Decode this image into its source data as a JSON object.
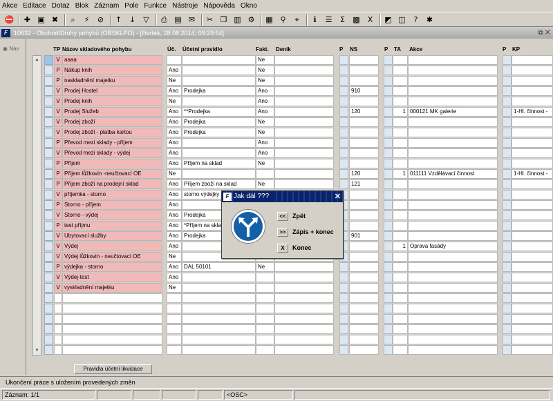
{
  "menu": [
    "Akce",
    "Editace",
    "Dotaz",
    "Blok",
    "Záznam",
    "Pole",
    "Funkce",
    "Nástroje",
    "Nápověda",
    "Okno"
  ],
  "toolbar_icons": [
    "exit-icon",
    "new-record-icon",
    "save-icon",
    "delete-icon",
    "query-icon",
    "execute-query-icon",
    "cancel-query-icon",
    "sort-asc-icon",
    "sort-desc-icon",
    "filter-icon",
    "print-icon",
    "print-preview-icon",
    "mail-icon",
    "cut-icon",
    "copy-icon",
    "paste-icon",
    "tools-icon",
    "calendar-icon",
    "attach-icon",
    "find-icon",
    "info-icon",
    "list-icon",
    "sum-icon",
    "calculator-icon",
    "excel-icon",
    "chart-icon",
    "window-icon",
    "help-icon",
    "settings-icon"
  ],
  "window": {
    "title": "10632 - Obchod/Druhy pohybů (OBSKLPO) - [čtvrtek, 28.08.2014; 09:29:54]"
  },
  "nav": {
    "label": "Nav"
  },
  "columns": {
    "tp": "TP",
    "name": "Název skladového pohybu",
    "uc": "Úč.",
    "rule": "Účetní pravidlo",
    "fakt": "Fakt.",
    "denik": "Deník",
    "p1": "P",
    "ns": "NS",
    "p2": "P",
    "ta": "TA",
    "akce": "Akce",
    "p3": "P",
    "kp": "KP"
  },
  "rows": [
    {
      "tp": "V",
      "name": "aaaa",
      "uc": "",
      "rule": "",
      "fakt": "Ne",
      "ns": "",
      "ta": "",
      "akce": "",
      "kp": ""
    },
    {
      "tp": "P",
      "name": "Nákup knih",
      "uc": "Ano",
      "rule": "",
      "fakt": "Ne",
      "ns": "",
      "ta": "",
      "akce": "",
      "kp": ""
    },
    {
      "tp": "P",
      "name": "naskladnění majetku",
      "uc": "Ne",
      "rule": "",
      "fakt": "Ne",
      "ns": "",
      "ta": "",
      "akce": "",
      "kp": ""
    },
    {
      "tp": "V",
      "name": "Prodej Hostel",
      "uc": "Ano",
      "rule": "Prodejka",
      "fakt": "Ano",
      "ns": "910",
      "ta": "",
      "akce": "",
      "kp": ""
    },
    {
      "tp": "V",
      "name": "Prodej knih",
      "uc": "Ne",
      "rule": "",
      "fakt": "Ano",
      "ns": "",
      "ta": "",
      "akce": "",
      "kp": ""
    },
    {
      "tp": "V",
      "name": "Prodej Služeb",
      "uc": "Ano",
      "rule": "**Prodejka",
      "fakt": "Ano",
      "ns": "120",
      "ta": "1",
      "akce": "000121 MK galerie",
      "kp": "1-Hl. činnost -"
    },
    {
      "tp": "V",
      "name": "Prodej zboží",
      "uc": "Ano",
      "rule": "Prodejka",
      "fakt": "Ne",
      "ns": "",
      "ta": "",
      "akce": "",
      "kp": ""
    },
    {
      "tp": "V",
      "name": "Prodej zboží - platba kartou",
      "uc": "Ano",
      "rule": "Prodejka",
      "fakt": "Ne",
      "ns": "",
      "ta": "",
      "akce": "",
      "kp": ""
    },
    {
      "tp": "P",
      "name": "Převod mezi sklady - příjem",
      "uc": "Ano",
      "rule": "",
      "fakt": "Ano",
      "ns": "",
      "ta": "",
      "akce": "",
      "kp": ""
    },
    {
      "tp": "V",
      "name": "Převod mezi sklady - výdej",
      "uc": "Ano",
      "rule": "",
      "fakt": "Ano",
      "ns": "",
      "ta": "",
      "akce": "",
      "kp": ""
    },
    {
      "tp": "P",
      "name": "Příjem",
      "uc": "Ano",
      "rule": "Příjem na sklad",
      "fakt": "Ne",
      "ns": "",
      "ta": "",
      "akce": "",
      "kp": ""
    },
    {
      "tp": "P",
      "name": "Příjem lůžkovin -neučtovací OE",
      "uc": "Ne",
      "rule": "",
      "fakt": "",
      "ns": "120",
      "ta": "1",
      "akce": "011111 Vzdělávací činnost",
      "kp": "1-Hl. činnost -"
    },
    {
      "tp": "P",
      "name": "Příjem zboží na prodejní sklad",
      "uc": "Ano",
      "rule": "Příjem zboží na sklad",
      "fakt": "Ne",
      "ns": "121",
      "ta": "",
      "akce": "",
      "kp": ""
    },
    {
      "tp": "V",
      "name": "příjemka - storno",
      "uc": "Ano",
      "rule": "storno výdejky",
      "fakt": "",
      "ns": "",
      "ta": "",
      "akce": "",
      "kp": ""
    },
    {
      "tp": "P",
      "name": "Storno - příjem",
      "uc": "Ano",
      "rule": "",
      "fakt": "",
      "ns": "",
      "ta": "",
      "akce": "",
      "kp": ""
    },
    {
      "tp": "V",
      "name": "Storno - výdej",
      "uc": "Ano",
      "rule": "Prodejka",
      "fakt": "",
      "ns": "",
      "ta": "",
      "akce": "",
      "kp": ""
    },
    {
      "tp": "P",
      "name": "test příjmu",
      "uc": "Ano",
      "rule": "*Příjem na sklad",
      "fakt": "",
      "ns": "",
      "ta": "",
      "akce": "",
      "kp": ""
    },
    {
      "tp": "V",
      "name": "Ubytovací služby",
      "uc": "Ano",
      "rule": "Prodejka",
      "fakt": "",
      "ns": "901",
      "ta": "",
      "akce": "",
      "kp": ""
    },
    {
      "tp": "V",
      "name": "Výdej",
      "uc": "Ano",
      "rule": "",
      "fakt": "",
      "ns": "",
      "ta": "1",
      "akce": "Oprava fasády",
      "kp": ""
    },
    {
      "tp": "V",
      "name": "Výdej lůžkovin - neučtovací OE",
      "uc": "Ne",
      "rule": "",
      "fakt": "",
      "ns": "",
      "ta": "",
      "akce": "",
      "kp": ""
    },
    {
      "tp": "P",
      "name": "výdejka - storno",
      "uc": "Ano",
      "rule": "DAL 50101",
      "fakt": "Ne",
      "ns": "",
      "ta": "",
      "akce": "",
      "kp": ""
    },
    {
      "tp": "V",
      "name": "Výdej-test",
      "uc": "Ano",
      "rule": "",
      "fakt": "",
      "ns": "",
      "ta": "",
      "akce": "",
      "kp": ""
    },
    {
      "tp": "V",
      "name": "vyskladnění majetku",
      "uc": "Ne",
      "rule": "",
      "fakt": "",
      "ns": "",
      "ta": "",
      "akce": "",
      "kp": ""
    },
    {
      "tp": "",
      "name": "",
      "uc": "",
      "rule": "",
      "fakt": "",
      "ns": "",
      "ta": "",
      "akce": "",
      "kp": ""
    },
    {
      "tp": "",
      "name": "",
      "uc": "",
      "rule": "",
      "fakt": "",
      "ns": "",
      "ta": "",
      "akce": "",
      "kp": ""
    },
    {
      "tp": "",
      "name": "",
      "uc": "",
      "rule": "",
      "fakt": "",
      "ns": "",
      "ta": "",
      "akce": "",
      "kp": ""
    },
    {
      "tp": "",
      "name": "",
      "uc": "",
      "rule": "",
      "fakt": "",
      "ns": "",
      "ta": "",
      "akce": "",
      "kp": ""
    },
    {
      "tp": "",
      "name": "",
      "uc": "",
      "rule": "",
      "fakt": "",
      "ns": "",
      "ta": "",
      "akce": "",
      "kp": ""
    },
    {
      "tp": "",
      "name": "",
      "uc": "",
      "rule": "",
      "fakt": "",
      "ns": "",
      "ta": "",
      "akce": "",
      "kp": ""
    }
  ],
  "buttons": {
    "rules": "Pravidla účetní likvidace"
  },
  "dialog": {
    "title": "Jak dál ???",
    "back_btn": "<<",
    "back_label": "Zpět",
    "save_btn": ">>",
    "save_label": "Zápis + konec",
    "end_btn": "X",
    "end_label": "Konec"
  },
  "status": {
    "message": "Ukončení práce s uložením provedených změn",
    "record": "Záznam: 1/1",
    "mode": "<OSC>"
  },
  "colors": {
    "pink": "#f2b9b9",
    "blue": "#dbe8f4",
    "dialog_title": "#0a246a",
    "sign_blue": "#1460a8"
  }
}
